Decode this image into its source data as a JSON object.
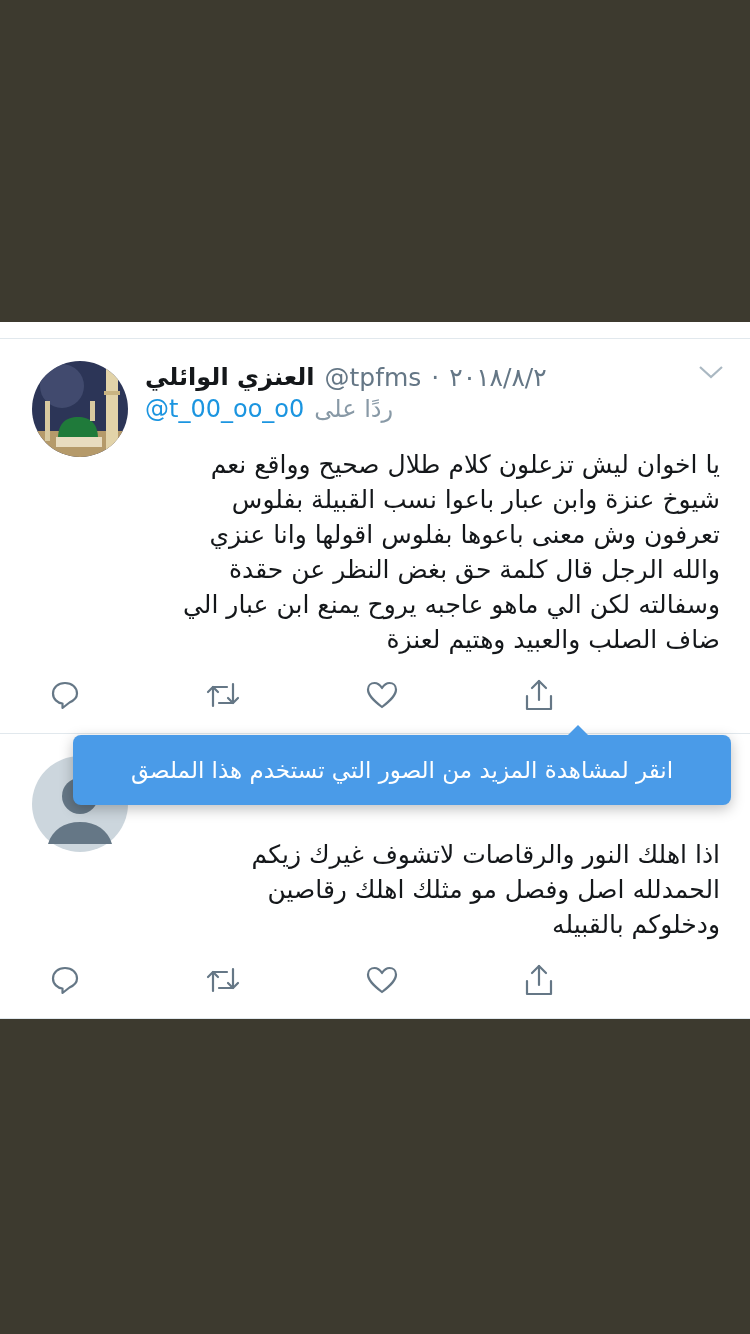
{
  "tweets": [
    {
      "display_name": "العنزي الوائلي",
      "handle": "@tpfms",
      "separator": "·",
      "date": "٢٠١٨/٨/٢",
      "reply_prefix": "ردًا على",
      "reply_handle": "@t_00_oo_o0",
      "lines": [
        "يا اخوان ليش تزعلون كلام طلال صحيح وواقع نعم",
        "شيوخ عنزة وابن عبار باعوا نسب القبيلة بفلوس",
        "تعرفون وش معنى باعوها بفلوس اقولها وانا عنزي",
        "والله الرجل قال كلمة حق بغض النظر عن حقدة",
        "وسفالته لكن الي ماهو عاجبه يروح يمنع ابن عبار الي",
        "ضاف الصلب والعبيد وهتيم لعنزة"
      ]
    },
    {
      "avatar": {
        "kind": "default"
      },
      "lines": [
        "اذا اهلك النور والرقاصات لاتشوف غيرك زيكم",
        "الحمدلله اصل وفصل مو مثلك اهلك رقاصين",
        "ودخلوكم بالقبيله"
      ]
    }
  ],
  "tooltip": {
    "text": "انقر لمشاهدة المزيد من الصور التي تستخدم هذا الملصق"
  }
}
